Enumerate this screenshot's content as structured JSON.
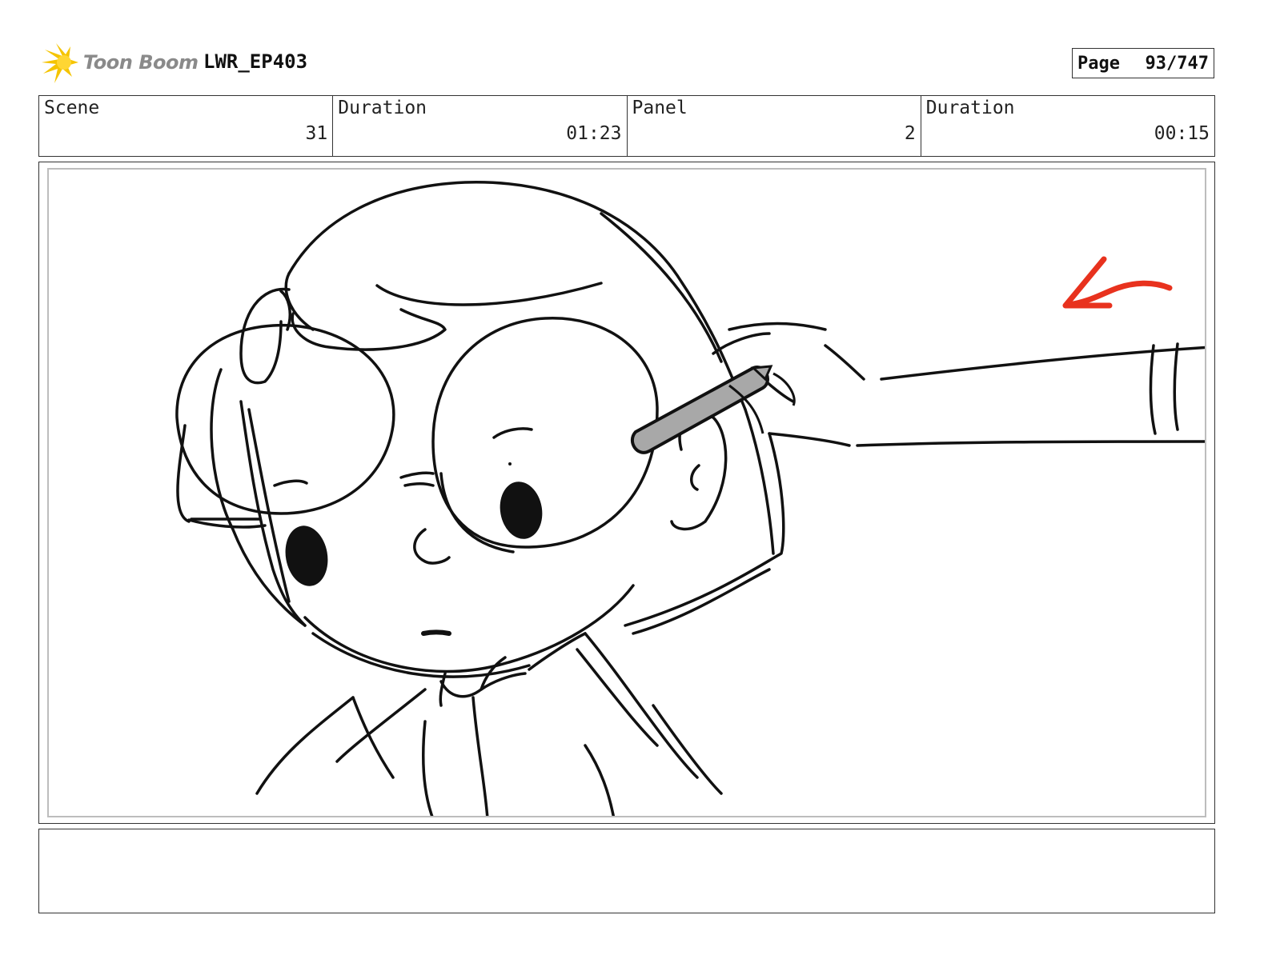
{
  "header": {
    "logo_text": "Toon Boom",
    "project_id": "LWR_EP403",
    "page_label": "Page",
    "page_value": "93/747"
  },
  "info": [
    {
      "label": "Scene",
      "value": "31"
    },
    {
      "label": "Duration",
      "value": "01:23"
    },
    {
      "label": "Panel",
      "value": "2"
    },
    {
      "label": "Duration",
      "value": "00:15"
    }
  ],
  "colors": {
    "logo_yellow": "#f5c400",
    "arrow_red": "#e8321e",
    "prop_gray": "#a8a8a8"
  }
}
